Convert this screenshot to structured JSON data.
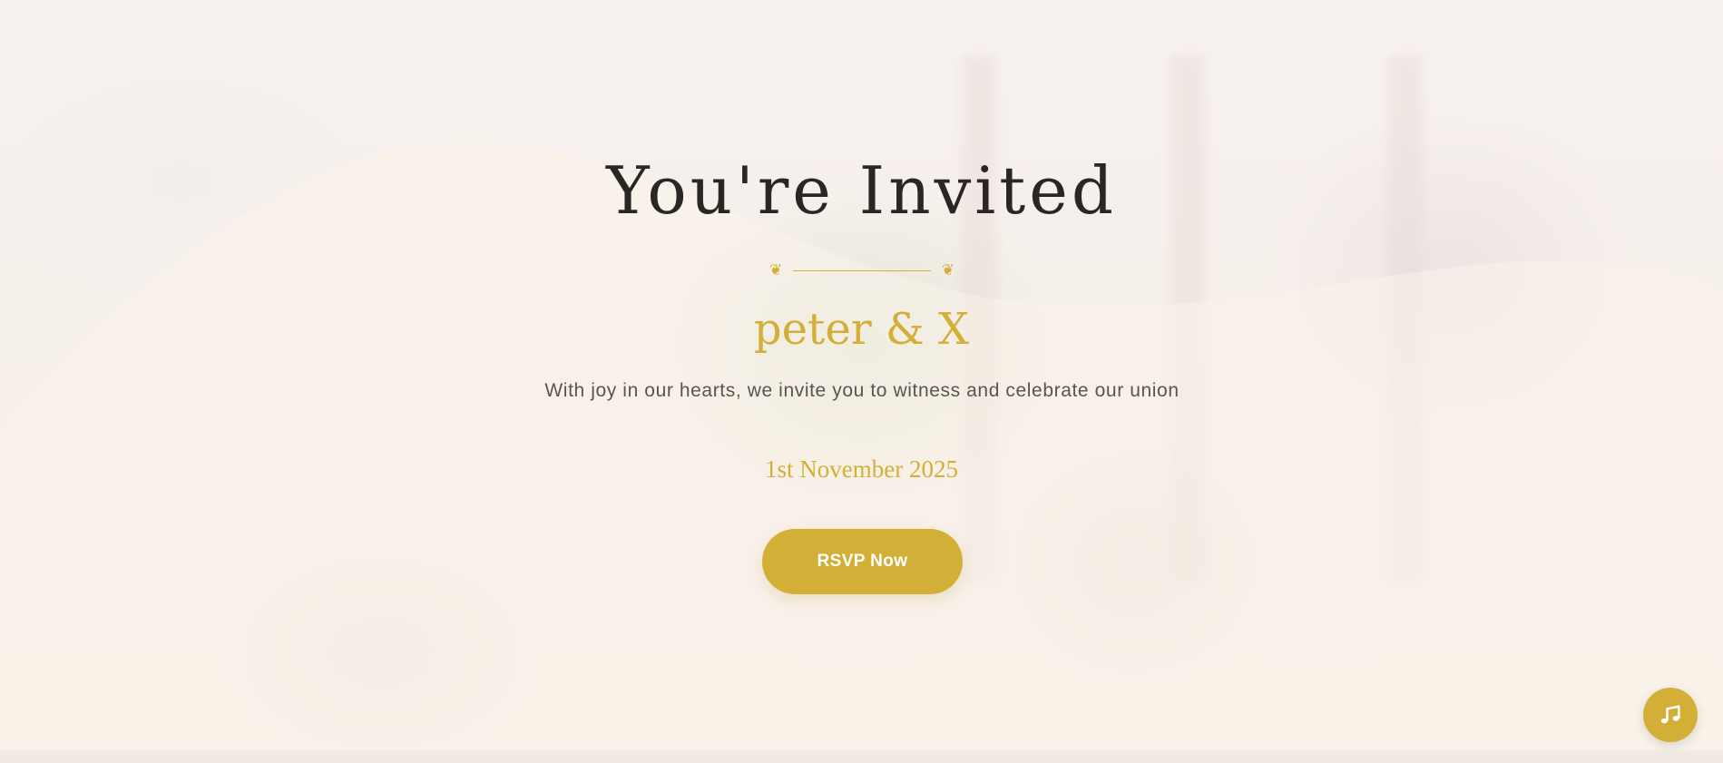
{
  "hero": {
    "title": "You're Invited",
    "names": "peter & X",
    "message": "With joy in our hearts, we invite you to witness and celebrate our union",
    "date": "1st November 2025",
    "rsvp_label": "RSVP Now"
  },
  "divider": {
    "ornament": "❦"
  },
  "music_button": {
    "icon": "music-note-icon"
  },
  "colors": {
    "accent": "#d4af37",
    "title": "#2a2624",
    "text": "#5a5450",
    "background": "#f7efe9"
  }
}
